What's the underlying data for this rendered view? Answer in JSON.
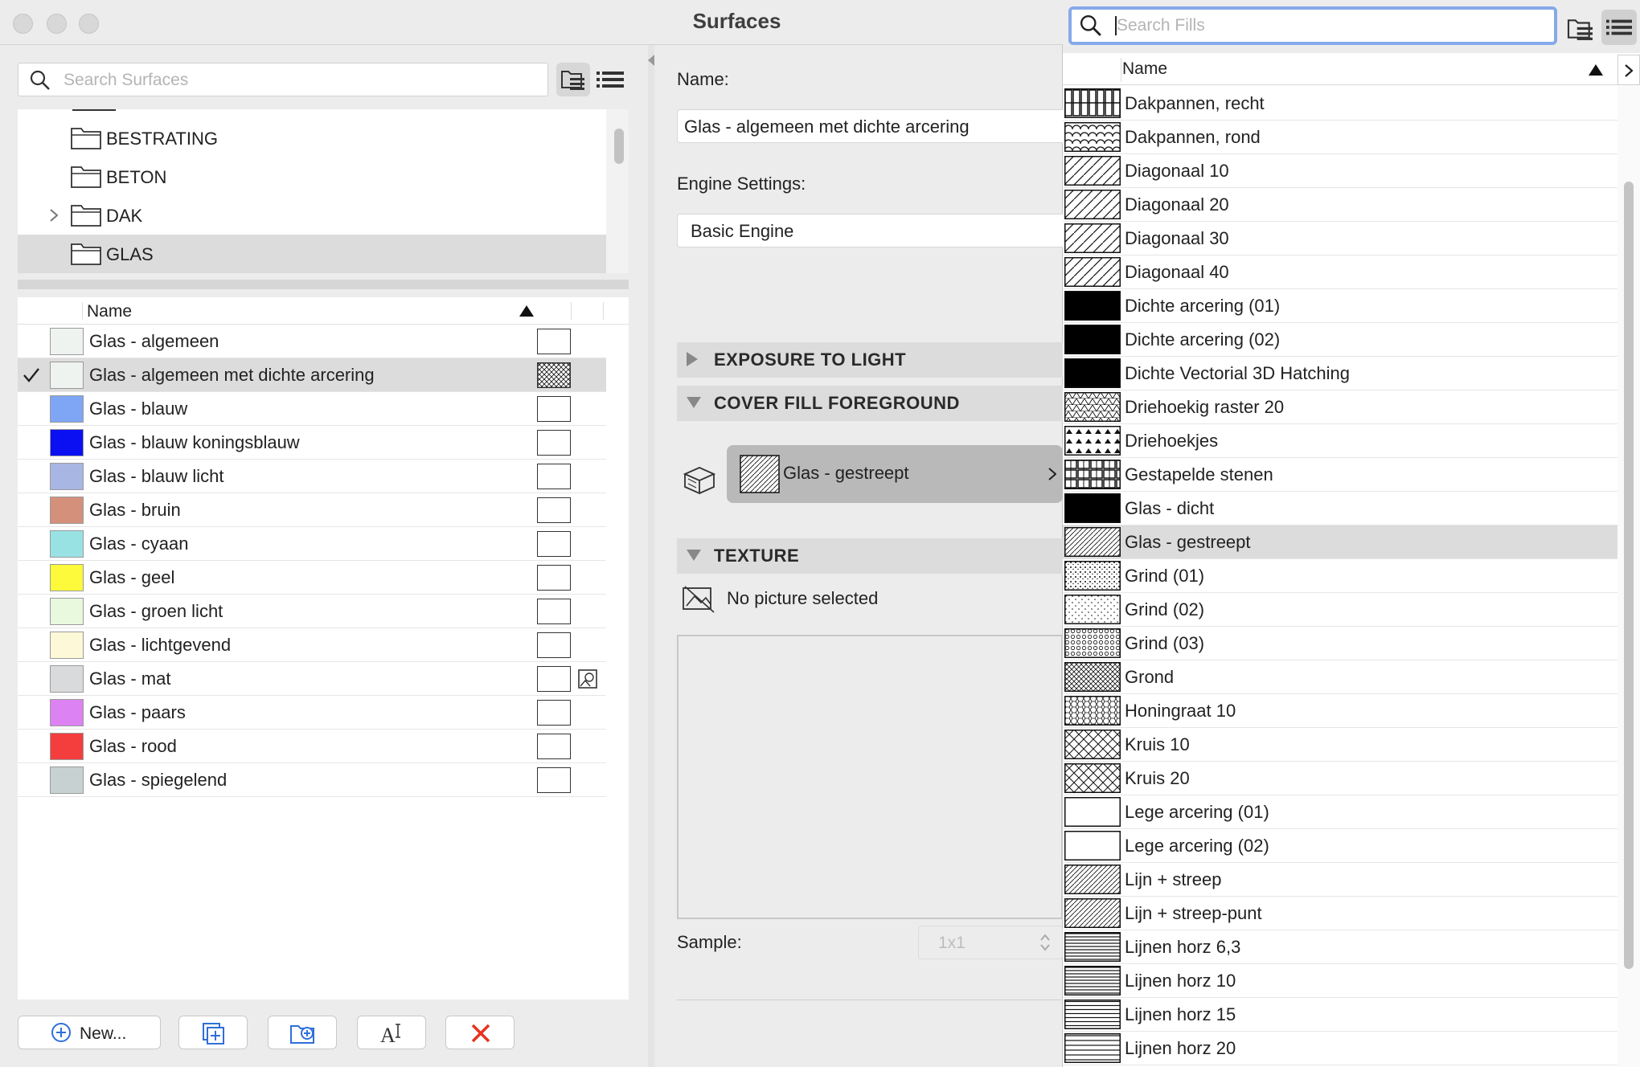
{
  "window": {
    "title": "Surfaces"
  },
  "left": {
    "search_placeholder": "Search Surfaces",
    "folders": [
      {
        "label": "BESTRATING",
        "expandable": false
      },
      {
        "label": "BETON",
        "expandable": false
      },
      {
        "label": "DAK",
        "expandable": true
      },
      {
        "label": "GLAS",
        "expandable": false,
        "selected": true
      }
    ],
    "list_header": "Name",
    "surfaces": [
      {
        "name": "Glas - algemeen",
        "color": "#eef3ef"
      },
      {
        "name": "Glas - algemeen met dichte arcering",
        "color": "#eef3ef",
        "checked": true,
        "fill": "hatch"
      },
      {
        "name": "Glas - blauw",
        "color": "#7ea6f5"
      },
      {
        "name": "Glas - blauw koningsblauw",
        "color": "#0a10f2"
      },
      {
        "name": "Glas - blauw licht",
        "color": "#a8b6e3"
      },
      {
        "name": "Glas - bruin",
        "color": "#d4907a"
      },
      {
        "name": "Glas - cyaan",
        "color": "#99e2e4"
      },
      {
        "name": "Glas - geel",
        "color": "#fcfa3a"
      },
      {
        "name": "Glas - groen licht",
        "color": "#e8f9de"
      },
      {
        "name": "Glas - lichtgevend",
        "color": "#fdf8d8"
      },
      {
        "name": "Glas - mat",
        "color": "#d8dadb",
        "has_texture": true
      },
      {
        "name": "Glas - paars",
        "color": "#dd82f2"
      },
      {
        "name": "Glas - rood",
        "color": "#f43d3d"
      },
      {
        "name": "Glas - spiegelend",
        "color": "#c7d1d1"
      }
    ],
    "buttons": {
      "new_label": "New..."
    }
  },
  "middle": {
    "name_label": "Name:",
    "name_value": "Glas - algemeen met dichte arcering",
    "engine_label": "Engine Settings:",
    "engine_value": "Basic Engine",
    "sections": {
      "exposure": "EXPOSURE TO LIGHT",
      "cover_fill": "COVER FILL FOREGROUND",
      "texture": "TEXTURE"
    },
    "cover_fill_value": "Glas - gestreept",
    "texture_text": "No picture selected",
    "sample_label": "Sample:",
    "sample_value": "1x1"
  },
  "fills": {
    "search_placeholder": "Search Fills",
    "header": "Name",
    "items": [
      {
        "name": "Dakpannen, recht",
        "pattern": "tiles"
      },
      {
        "name": "Dakpannen, rond",
        "pattern": "scallop"
      },
      {
        "name": "Diagonaal 10",
        "pattern": "diag"
      },
      {
        "name": "Diagonaal 20",
        "pattern": "diag"
      },
      {
        "name": "Diagonaal 30",
        "pattern": "diag"
      },
      {
        "name": "Diagonaal 40",
        "pattern": "diag"
      },
      {
        "name": "Dichte arcering (01)",
        "pattern": "solid"
      },
      {
        "name": "Dichte arcering (02)",
        "pattern": "solid"
      },
      {
        "name": "Dichte Vectorial 3D Hatching",
        "pattern": "solid"
      },
      {
        "name": "Driehoekig raster 20",
        "pattern": "tri"
      },
      {
        "name": "Driehoekjes",
        "pattern": "tri2"
      },
      {
        "name": "Gestapelde stenen",
        "pattern": "bricks"
      },
      {
        "name": "Glas - dicht",
        "pattern": "solid"
      },
      {
        "name": "Glas - gestreept",
        "pattern": "fine",
        "selected": true
      },
      {
        "name": "Grind (01)",
        "pattern": "dots"
      },
      {
        "name": "Grind (02)",
        "pattern": "dots2"
      },
      {
        "name": "Grind (03)",
        "pattern": "dots3"
      },
      {
        "name": "Grond",
        "pattern": "cross"
      },
      {
        "name": "Honingraat 10",
        "pattern": "honey"
      },
      {
        "name": "Kruis 10",
        "pattern": "xcross"
      },
      {
        "name": "Kruis 20",
        "pattern": "xcross"
      },
      {
        "name": "Lege arcering (01)",
        "pattern": "empty"
      },
      {
        "name": "Lege arcering (02)",
        "pattern": "empty"
      },
      {
        "name": "Lijn + streep",
        "pattern": "fine"
      },
      {
        "name": "Lijn + streep-punt",
        "pattern": "fine"
      },
      {
        "name": "Lijnen horz  6,3",
        "pattern": "hl"
      },
      {
        "name": "Lijnen horz 10",
        "pattern": "hl"
      },
      {
        "name": "Lijnen horz 15",
        "pattern": "hl2"
      },
      {
        "name": "Lijnen horz 20",
        "pattern": "hl3"
      }
    ]
  }
}
